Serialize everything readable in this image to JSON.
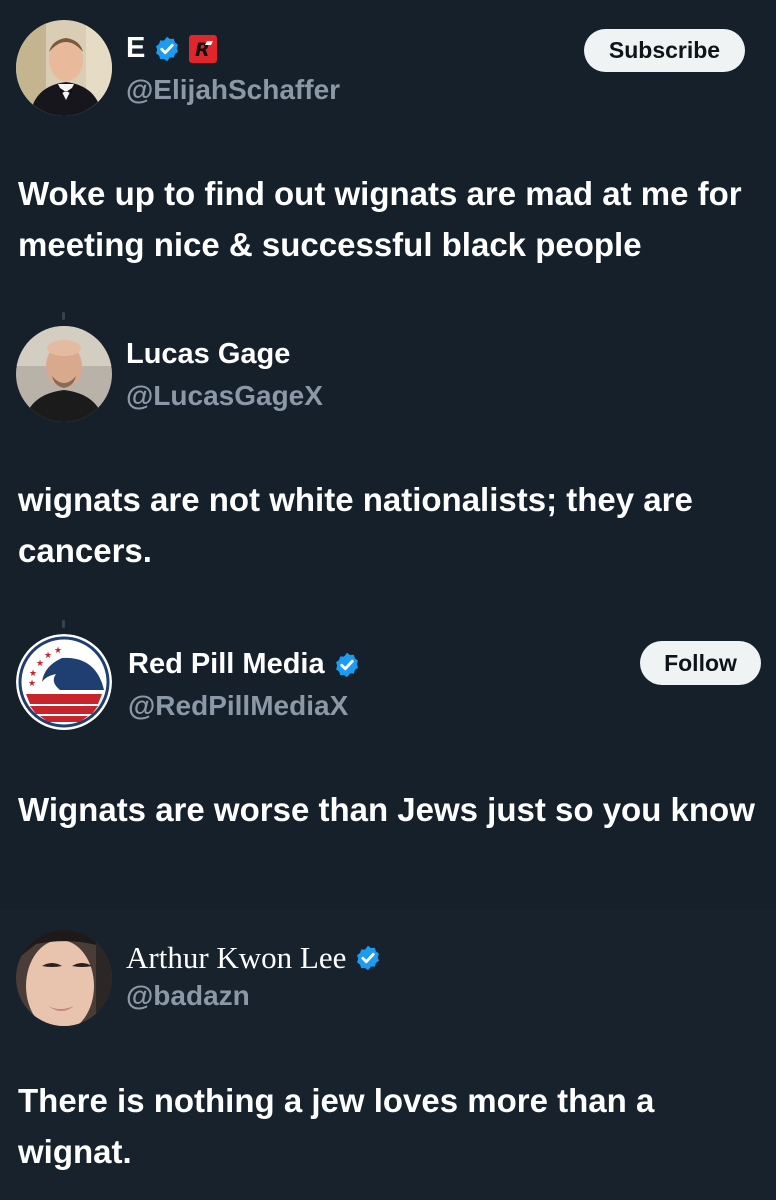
{
  "posts": [
    {
      "name": "E",
      "handle": "@ElijahSchaffer",
      "verified": true,
      "brand_icon": "r-logo-icon",
      "action_label": "Subscribe",
      "text": "Woke up to find out wignats are mad at me for meeting nice & successful black people"
    },
    {
      "name": "Lucas Gage",
      "handle": "@LucasGageX",
      "verified": false,
      "text": "wignats are not white nationalists; they are cancers."
    },
    {
      "name": "Red Pill Media",
      "handle": "@RedPillMediaX",
      "verified": true,
      "action_label": "Follow",
      "text": "Wignats are worse than Jews just so you know"
    },
    {
      "name": "Arthur Kwon Lee",
      "handle": "@badazn",
      "verified": true,
      "text": "There is nothing a jew loves more than a wignat."
    }
  ],
  "colors": {
    "background": "#15202b",
    "text": "#ffffff",
    "secondary": "#8b98a5",
    "verified": "#1d9bf0",
    "pill_bg": "#eff3f4"
  }
}
